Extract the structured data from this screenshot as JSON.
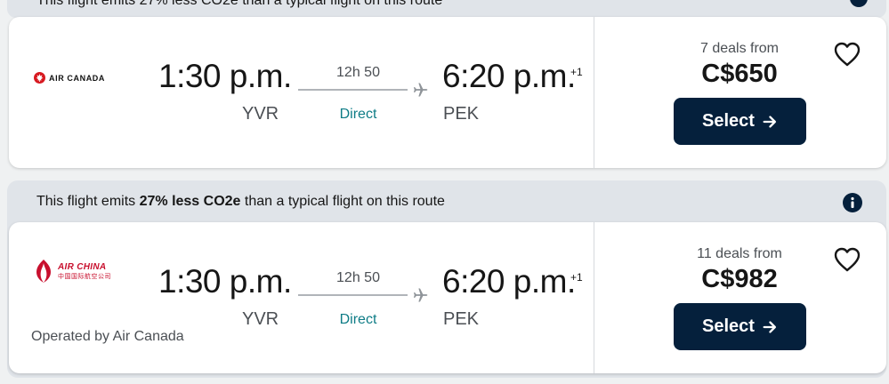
{
  "top_banner": {
    "text": "This flight emits 27% less CO2e than a typical flight on this route"
  },
  "flights": [
    {
      "airline": "AIR CANADA",
      "logo_icon": "air-canada-maple-leaf-icon",
      "departure_time": "1:30 p.m.",
      "departure_code": "YVR",
      "arrival_time": "6:20 p.m.",
      "arrival_day_offset": "+1",
      "arrival_code": "PEK",
      "duration": "12h 50",
      "stops": "Direct",
      "deals": "7 deals from",
      "price": "C$650",
      "select_label": "Select"
    },
    {
      "airline": "AIR CHINA",
      "airline_cn": "中国国际航空公司",
      "logo_icon": "air-china-phoenix-icon",
      "banner_prefix": "This flight emits ",
      "banner_bold": "27% less CO2e",
      "banner_suffix": " than a typical flight on this route",
      "departure_time": "1:30 p.m.",
      "departure_code": "YVR",
      "arrival_time": "6:20 p.m.",
      "arrival_day_offset": "+1",
      "arrival_code": "PEK",
      "duration": "12h 50",
      "stops": "Direct",
      "operated_by": "Operated by Air Canada",
      "deals": "11 deals from",
      "price": "C$982",
      "select_label": "Select"
    }
  ],
  "colors": {
    "select_bg": "#05203c",
    "direct": "#0e7c86",
    "banner_bg": "#e0e4e9",
    "air_china_red": "#c8102e"
  }
}
